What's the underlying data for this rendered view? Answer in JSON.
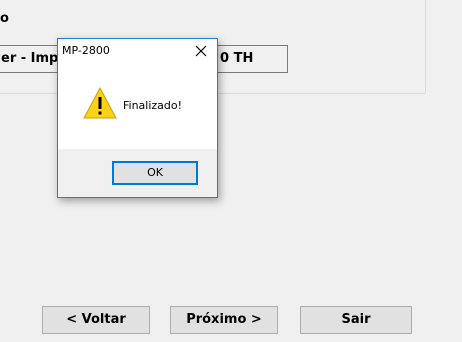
{
  "background_window": {
    "label_fragment": "o",
    "field_text": "er - Impre",
    "field_text_right": "0 TH"
  },
  "wizard_buttons": {
    "back_label": "< Voltar",
    "next_label": "Próximo >",
    "exit_label": "Sair"
  },
  "dialog": {
    "title": "MP-2800",
    "message": "Finalizado!",
    "ok_label": "OK",
    "icon": "warning-icon",
    "close_icon": "close-icon"
  },
  "colors": {
    "accent": "#0078d7",
    "warning": "#fcd116"
  }
}
